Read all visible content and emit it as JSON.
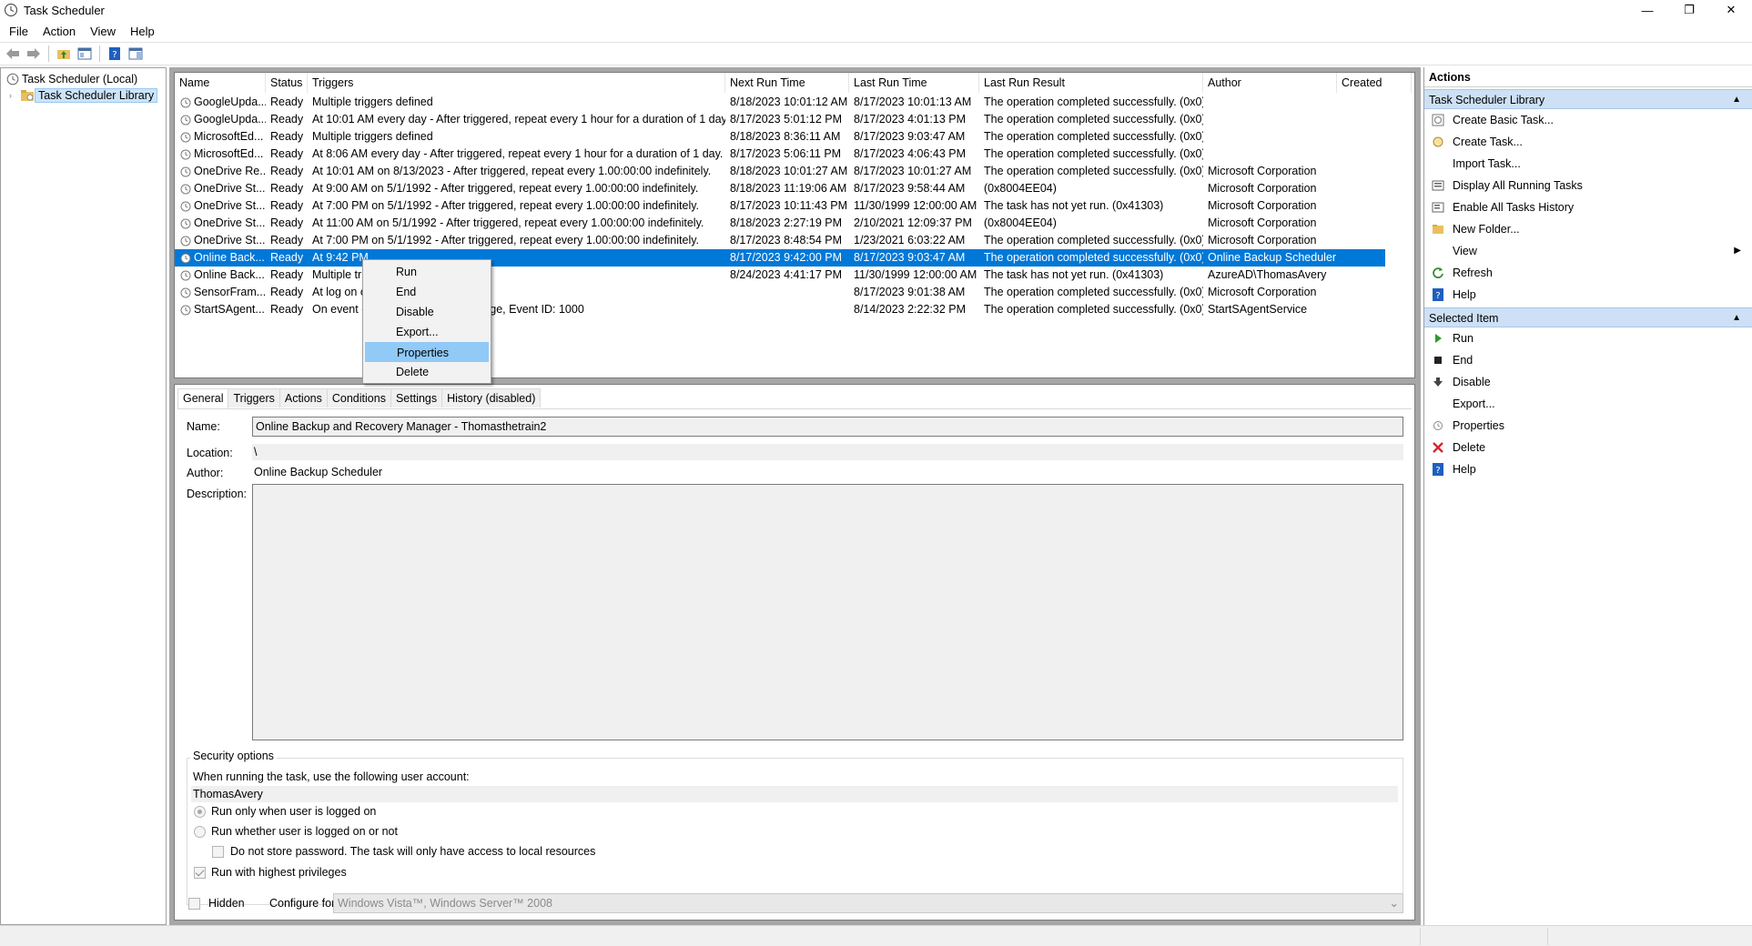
{
  "window": {
    "title": "Task Scheduler",
    "min": "—",
    "restore": "❐",
    "close": "✕"
  },
  "menu": {
    "file": "File",
    "action": "Action",
    "view": "View",
    "help": "Help"
  },
  "tree": {
    "root": "Task Scheduler (Local)",
    "library": "Task Scheduler Library"
  },
  "table": {
    "headers": [
      "Name",
      "Status",
      "Triggers",
      "Next Run Time",
      "Last Run Time",
      "Last Run Result",
      "Author",
      "Created"
    ],
    "rows": [
      [
        "GoogleUpda...",
        "Ready",
        "Multiple triggers defined",
        "8/18/2023 10:01:12 AM",
        "8/17/2023 10:01:13 AM",
        "The operation completed successfully. (0x0)",
        ""
      ],
      [
        "GoogleUpda...",
        "Ready",
        "At 10:01 AM every day - After triggered, repeat every 1 hour for a duration of 1 day.",
        "8/17/2023 5:01:12 PM",
        "8/17/2023 4:01:13 PM",
        "The operation completed successfully. (0x0)",
        ""
      ],
      [
        "MicrosoftEd...",
        "Ready",
        "Multiple triggers defined",
        "8/18/2023 8:36:11 AM",
        "8/17/2023 9:03:47 AM",
        "The operation completed successfully. (0x0)",
        ""
      ],
      [
        "MicrosoftEd...",
        "Ready",
        "At 8:06 AM every day - After triggered, repeat every 1 hour for a duration of 1 day.",
        "8/17/2023 5:06:11 PM",
        "8/17/2023 4:06:43 PM",
        "The operation completed successfully. (0x0)",
        ""
      ],
      [
        "OneDrive Re...",
        "Ready",
        "At 10:01 AM on 8/13/2023 - After triggered, repeat every 1.00:00:00 indefinitely.",
        "8/18/2023 10:01:27 AM",
        "8/17/2023 10:01:27 AM",
        "The operation completed successfully. (0x0)",
        "Microsoft Corporation"
      ],
      [
        "OneDrive St...",
        "Ready",
        "At 9:00 AM on 5/1/1992 - After triggered, repeat every 1.00:00:00 indefinitely.",
        "8/18/2023 11:19:06 AM",
        "8/17/2023 9:58:44 AM",
        "(0x8004EE04)",
        "Microsoft Corporation"
      ],
      [
        "OneDrive St...",
        "Ready",
        "At 7:00 PM on 5/1/1992 - After triggered, repeat every 1.00:00:00 indefinitely.",
        "8/17/2023 10:11:43 PM",
        "11/30/1999 12:00:00 AM",
        "The task has not yet run. (0x41303)",
        "Microsoft Corporation"
      ],
      [
        "OneDrive St...",
        "Ready",
        "At 11:00 AM on 5/1/1992 - After triggered, repeat every 1.00:00:00 indefinitely.",
        "8/18/2023 2:27:19 PM",
        "2/10/2021 12:09:37 PM",
        "(0x8004EE04)",
        "Microsoft Corporation"
      ],
      [
        "OneDrive St...",
        "Ready",
        "At 7:00 PM on 5/1/1992 - After triggered, repeat every 1.00:00:00 indefinitely.",
        "8/17/2023 8:48:54 PM",
        "1/23/2021 6:03:22 AM",
        "The operation completed successfully. (0x0)",
        "Microsoft Corporation"
      ],
      [
        "Online Back...",
        "Ready",
        "At 9:42 PM",
        "8/17/2023 9:42:00 PM",
        "8/17/2023 9:03:47 AM",
        "The operation completed successfully. (0x0)",
        "Online Backup Scheduler"
      ],
      [
        "Online Back...",
        "Ready",
        "Multiple tr",
        "8/24/2023 4:41:17 PM",
        "11/30/1999 12:00:00 AM",
        "The task has not yet run. (0x41303)",
        "AzureAD\\ThomasAvery"
      ],
      [
        "SensorFram...",
        "Ready",
        "At log on o",
        "",
        "8/17/2023 9:01:38 AM",
        "The operation completed successfully. (0x0)",
        "Microsoft Corporation"
      ],
      [
        "StartSAgent...",
        "Ready",
        "On event -",
        "",
        "8/14/2023 2:22:32 PM",
        "The operation completed successfully. (0x0)",
        "StartSAgentService"
      ]
    ],
    "trigger_tail_last": "Storage, Event ID: 1000"
  },
  "context_menu": {
    "run": "Run",
    "end": "End",
    "disable": "Disable",
    "export": "Export...",
    "properties": "Properties",
    "delete": "Delete"
  },
  "detail": {
    "tabs": [
      "General",
      "Triggers",
      "Actions",
      "Conditions",
      "Settings",
      "History (disabled)"
    ],
    "name_label": "Name:",
    "name_value": "Online Backup and Recovery Manager - Thomasthetrain2",
    "location_label": "Location:",
    "location_value": "\\",
    "author_label": "Author:",
    "author_value": "Online Backup Scheduler",
    "description_label": "Description:",
    "security_title": "Security options",
    "account_prompt": "When running the task, use the following user account:",
    "account_value": "ThomasAvery",
    "opt_logged_on": "Run only when user is logged on",
    "opt_whether": "Run whether user is logged on or not",
    "opt_no_store": "Do not store password.  The task will only have access to local resources",
    "opt_highest": "Run with highest privileges",
    "hidden_label": "Hidden",
    "configure_label": "Configure for:",
    "configure_value": "Windows Vista™, Windows Server™ 2008"
  },
  "actions_pane": {
    "title": "Actions",
    "section1": "Task Scheduler Library",
    "items1": [
      "Create Basic Task...",
      "Create Task...",
      "Import Task...",
      "Display All Running Tasks",
      "Enable All Tasks History",
      "New Folder...",
      "View",
      "Refresh",
      "Help"
    ],
    "section2": "Selected Item",
    "items2": [
      "Run",
      "End",
      "Disable",
      "Export...",
      "Properties",
      "Delete",
      "Help"
    ]
  },
  "colors": {
    "selection": "#0078d7",
    "section_header": "#cde0f5",
    "menu_highlight": "#91c9f7"
  }
}
